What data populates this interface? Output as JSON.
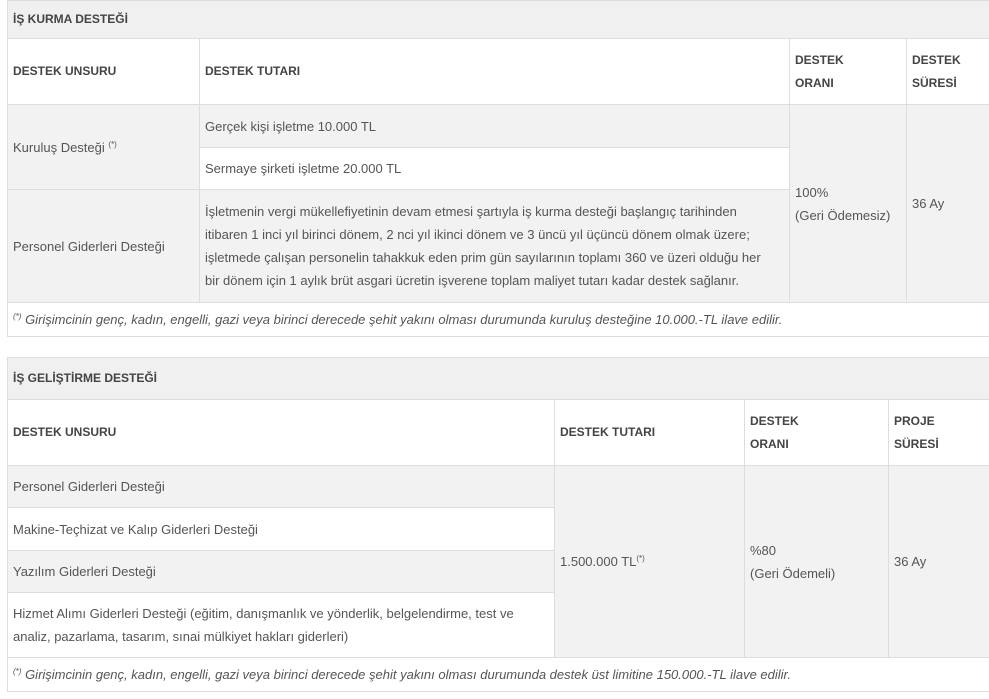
{
  "section1": {
    "title": "İŞ KURMA DESTEĞİ",
    "headers": {
      "unsur": "DESTEK UNSURU",
      "tutar": "DESTEK TUTARI",
      "oran_1": "DESTEK",
      "oran_2": "ORANI",
      "sure_1": "DESTEK",
      "sure_2": "SÜRESİ"
    },
    "rows": [
      {
        "unsur": "Kuruluş Desteği",
        "unsur_sup": "(*)",
        "tutar_a": "Gerçek kişi işletme 10.000 TL",
        "tutar_b": "Sermaye şirketi işletme 20.000 TL"
      },
      {
        "unsur": "Personel Giderleri Desteği",
        "tutar_lines": [
          "İşletmenin vergi mükellefiyetinin devam etmesi şartıyla iş kurma desteği başlangıç tarihinden",
          "itibaren 1 inci yıl birinci dönem, 2 nci yıl ikinci dönem ve 3 üncü yıl üçüncü dönem olmak üzere;",
          "işletmede çalışan personelin tahakkuk eden prim gün sayılarının toplamı 360 ve üzeri olduğu her",
          "bir dönem için 1 aylık brüt asgari ücretin işverene toplam maliyet tutarı kadar destek sağlanır."
        ]
      }
    ],
    "oran_value": "100%",
    "oran_note": "(Geri Ödemesiz)",
    "sure_value": "36 Ay",
    "footnote_mark": "(*)",
    "footnote": " Girişimcinin genç, kadın, engelli, gazi veya birinci derecede şehit yakını olması durumunda kuruluş desteğine 10.000.-TL ilave edilir."
  },
  "section2": {
    "title": "İŞ GELİŞTİRME DESTEĞİ",
    "headers": {
      "unsur": "DESTEK UNSURU",
      "tutar": "DESTEK TUTARI",
      "oran_1": "DESTEK",
      "oran_2": "ORANI",
      "sure_1": "PROJE",
      "sure_2": "SÜRESİ"
    },
    "rows": [
      {
        "unsur_lines": [
          "Personel Giderleri Desteği"
        ]
      },
      {
        "unsur_lines": [
          "Makine-Teçhizat ve Kalıp Giderleri Desteği"
        ]
      },
      {
        "unsur_lines": [
          "Yazılım Giderleri Desteği"
        ]
      },
      {
        "unsur_lines": [
          "Hizmet Alımı Giderleri Desteği (eğitim, danışmanlık ve yönderlik, belgelendirme, test ve",
          "analiz, pazarlama, tasarım, sınai mülkiyet hakları giderleri)"
        ]
      }
    ],
    "tutar_value": "1.500.000 TL",
    "tutar_sup": "(*)",
    "oran_value": "%80",
    "oran_note": "(Geri Ödemeli)",
    "sure_value": "36 Ay",
    "footnote_mark": "(*)",
    "footnote": " Girişimcinin genç, kadın, engelli, gazi veya birinci derecede şehit yakını olması durumunda destek üst limitine 150.000.-TL ilave edilir."
  }
}
